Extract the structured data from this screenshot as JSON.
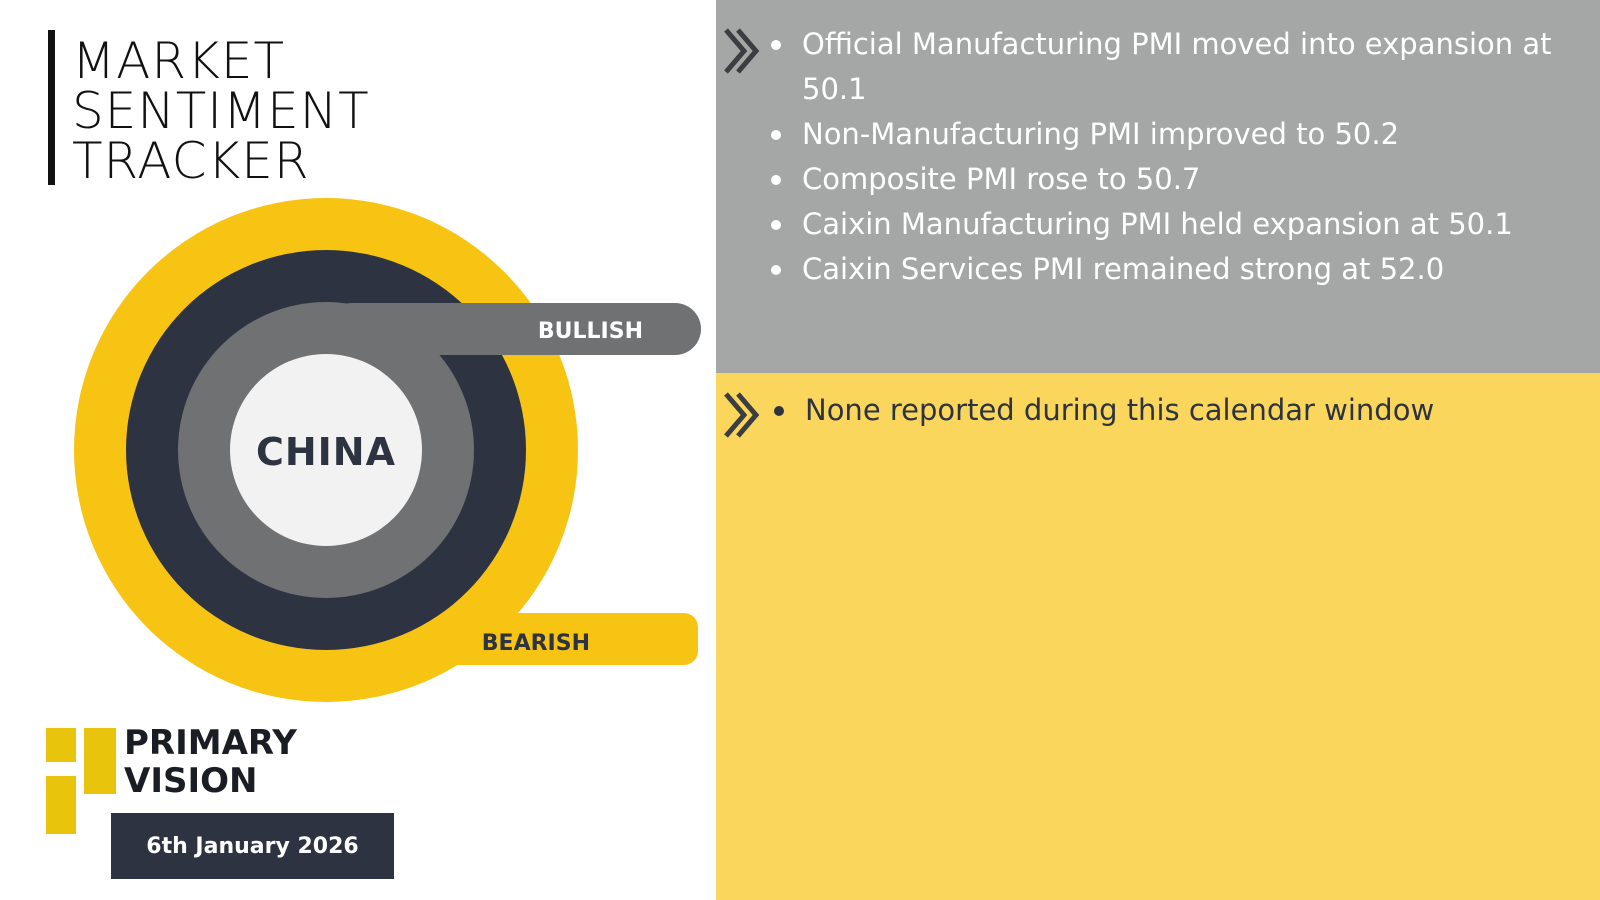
{
  "title": {
    "line1": "MARKET",
    "line2": "SENTIMENT",
    "line3": "TRACKER"
  },
  "gauge": {
    "center_label": "CHINA",
    "bullish_label": "BULLISH",
    "bearish_label": "BEARISH"
  },
  "brand": {
    "line1": "PRIMARY",
    "line2": "VISION"
  },
  "date": "6th January 2026",
  "top_section": {
    "items": [
      "Official Manufacturing PMI moved into expansion at 50.1",
      "Non-Manufacturing PMI improved to 50.2",
      "Composite PMI rose to 50.7",
      "Caixin Manufacturing PMI held expansion at 50.1",
      "Caixin Services PMI remained strong at 52.0"
    ]
  },
  "bottom_section": {
    "items": [
      "None reported during this calendar window"
    ]
  },
  "colors": {
    "yellow": "#f8c414",
    "dark": "#2d3340",
    "grey": "#6f7172",
    "panel_grey": "#a5a6a6",
    "panel_yellow": "#fad75c"
  },
  "icons": {
    "section_marker": "double-chevron-right-icon"
  }
}
